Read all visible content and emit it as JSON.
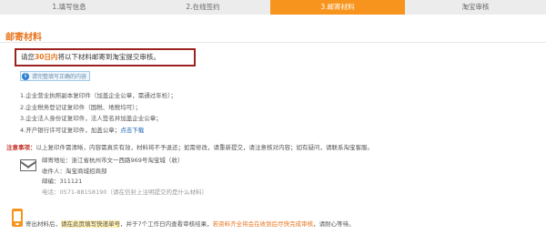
{
  "steps": [
    {
      "label": "1.填写信息"
    },
    {
      "label": "2.在线签约"
    },
    {
      "label": "3.邮寄材料"
    },
    {
      "label": "淘宝审核"
    }
  ],
  "section_title": "邮寄材料",
  "notice": {
    "pre": "请您",
    "highlight": "30日内",
    "post": "将以下材料邮寄到淘宝提交审核。"
  },
  "info_badge": "请完整填写正确的内容",
  "materials": [
    "1.企业营业执照副本复印件（加盖企业公章，需通过年检）；",
    "2.企业税务登记证复印件（国税、地税均可）；",
    "3.企业法人身份证复印件，法人签名并加盖企业公章；",
    "4.开户银行许可证复印件，加盖公章；"
  ],
  "materials_link": "点击下载",
  "attention": {
    "label": "注意事项：",
    "text": "以上复印件需清晰，内容需真实有效，材料将不予退还；如需修改，请重新提交，请注意核对内容；如有疑问，请联系淘宝客服。"
  },
  "address": {
    "line1": "邮寄地址：浙江省杭州市文一西路969号淘宝城（收）",
    "line2": "收件人：淘宝商城招商部",
    "line3": "邮编：311121",
    "line4": "电话：0571-88158190（请在信封上注明提交的是什么材料）"
  },
  "footer": {
    "pre": "寄出材料后，",
    "mark": "请在此页填写快递单号",
    "mid": "，并于7个工作日内查看审核结果，",
    "hl": "若资料齐全将会在收到后尽快完成审核",
    "post": "，请耐心等待。"
  },
  "colors": {
    "accent": "#f7941d",
    "notice_border": "#9c2121",
    "title": "#e8741b"
  }
}
